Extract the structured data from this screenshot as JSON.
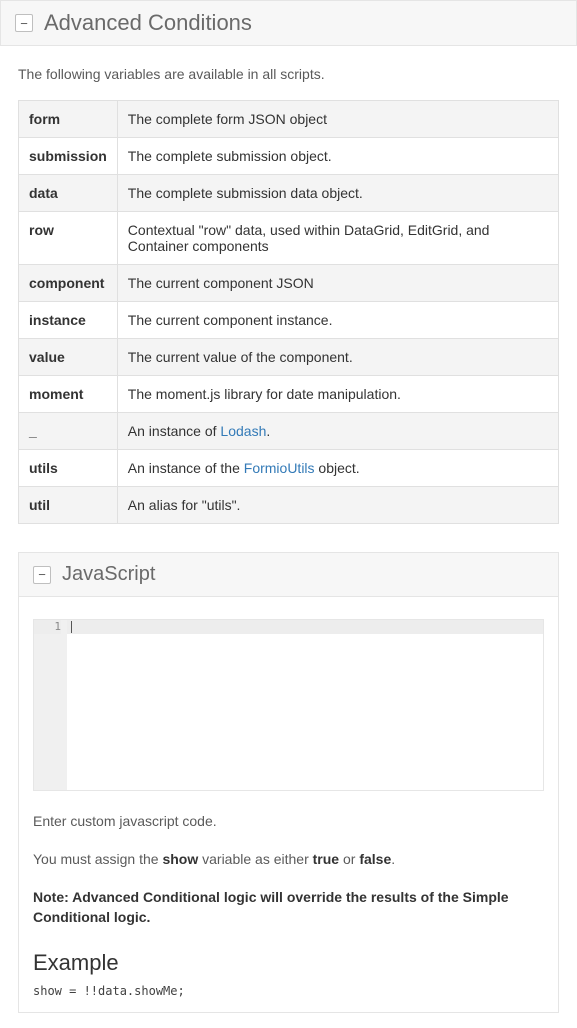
{
  "header": {
    "title": "Advanced Conditions",
    "toggle_glyph": "−"
  },
  "intro": "The following variables are available in all scripts.",
  "vars": [
    {
      "name": "form",
      "desc": "The complete form JSON object"
    },
    {
      "name": "submission",
      "desc": "The complete submission object."
    },
    {
      "name": "data",
      "desc": "The complete submission data object."
    },
    {
      "name": "row",
      "desc": "Contextual \"row\" data, used within DataGrid, EditGrid, and Container components"
    },
    {
      "name": "component",
      "desc": "The current component JSON"
    },
    {
      "name": "instance",
      "desc": "The current component instance."
    },
    {
      "name": "value",
      "desc": "The current value of the component."
    },
    {
      "name": "moment",
      "desc": "The moment.js library for date manipulation."
    },
    {
      "name": "_",
      "desc_pre": "An instance of ",
      "link": "Lodash",
      "desc_post": "."
    },
    {
      "name": "utils",
      "desc_pre": "An instance of the ",
      "link": "FormioUtils",
      "desc_post": " object."
    },
    {
      "name": "util",
      "desc": "An alias for \"utils\"."
    }
  ],
  "js_panel": {
    "title": "JavaScript",
    "toggle_glyph": "−",
    "line_number": "1",
    "help1": "Enter custom javascript code.",
    "help2_pre": "You must assign the ",
    "help2_show": "show",
    "help2_mid": " variable as either ",
    "help2_true": "true",
    "help2_or": " or ",
    "help2_false": "false",
    "help2_post": ".",
    "note": "Note: Advanced Conditional logic will override the results of the Simple Conditional logic.",
    "example_heading": "Example",
    "example_code": "show = !!data.showMe;"
  }
}
